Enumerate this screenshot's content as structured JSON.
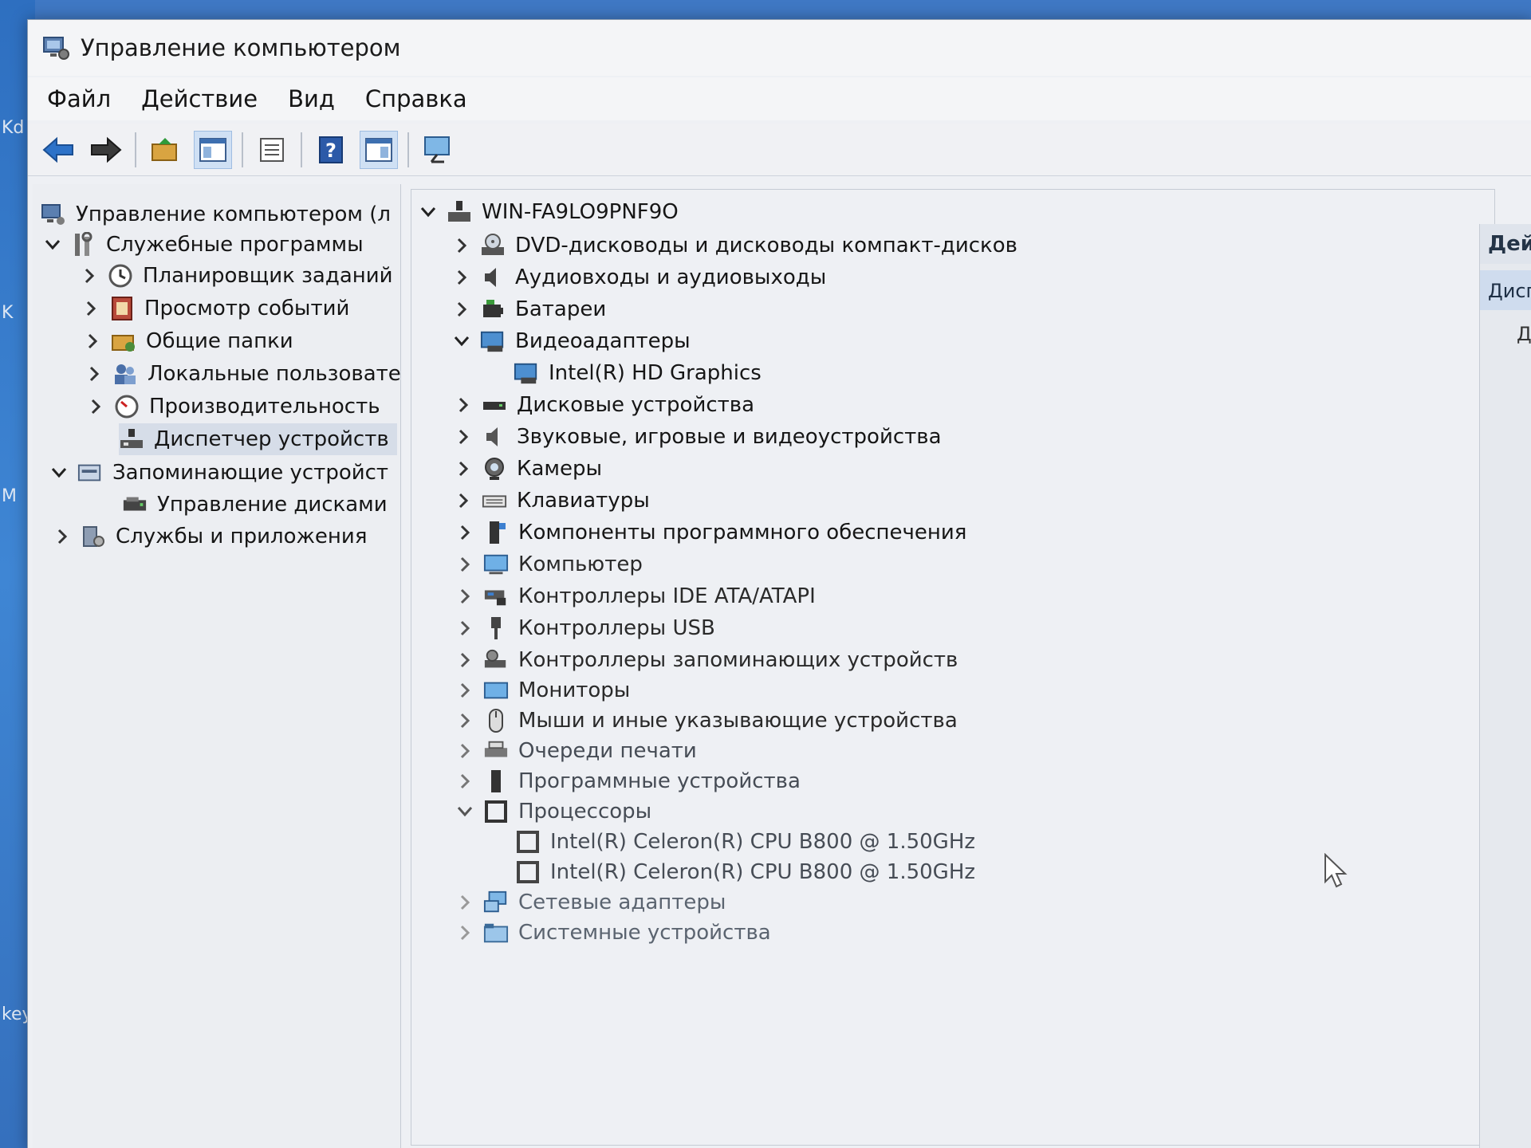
{
  "desktop": {
    "side_labels": [
      "Kd",
      "K",
      "M",
      "key"
    ]
  },
  "window": {
    "title": "Управление компьютером",
    "menu": [
      "Файл",
      "Действие",
      "Вид",
      "Справка"
    ]
  },
  "toolbar": {
    "icons": [
      "back-arrow-icon",
      "forward-arrow-icon",
      "up-folder-icon",
      "show-hide-tree-icon",
      "export-list-icon",
      "help-icon",
      "properties-icon",
      "monitor-icon"
    ]
  },
  "left_tree": {
    "root": "Управление компьютером (л",
    "system_tools": {
      "label": "Служебные программы",
      "children": [
        "Планировщик заданий",
        "Просмотр событий",
        "Общие папки",
        "Локальные пользовате",
        "Производительность",
        "Диспетчер устройств"
      ]
    },
    "storage": {
      "label": "Запоминающие устройст",
      "children": [
        "Управление дисками"
      ]
    },
    "services": {
      "label": "Службы и приложения"
    }
  },
  "device_tree": {
    "computer_name": "WIN-FA9LO9PNF9O",
    "categories": [
      "DVD-дисководы и дисководы компакт-дисков",
      "Аудиовходы и аудиовыходы",
      "Батареи",
      "Видеоадаптеры",
      "Дисковые устройства",
      "Звуковые, игровые и видеоустройства",
      "Камеры",
      "Клавиатуры",
      "Компоненты программного обеспечения",
      "Компьютер",
      "Контроллеры IDE ATA/ATAPI",
      "Контроллеры USB",
      "Контроллеры запоминающих устройств",
      "Мониторы",
      "Мыши и иные указывающие устройства",
      "Очереди печати",
      "Программные устройства",
      "Процессоры",
      "Сетевые адаптеры",
      "Системные устройства"
    ],
    "video_adapters": [
      "Intel(R) HD Graphics"
    ],
    "processors": [
      "Intel(R) Celeron(R) CPU B800 @ 1.50GHz",
      "Intel(R) Celeron(R) CPU B800 @ 1.50GHz"
    ]
  },
  "actions_pane": {
    "header": "Дейс",
    "selected": "Дисп",
    "sub": "Д"
  }
}
